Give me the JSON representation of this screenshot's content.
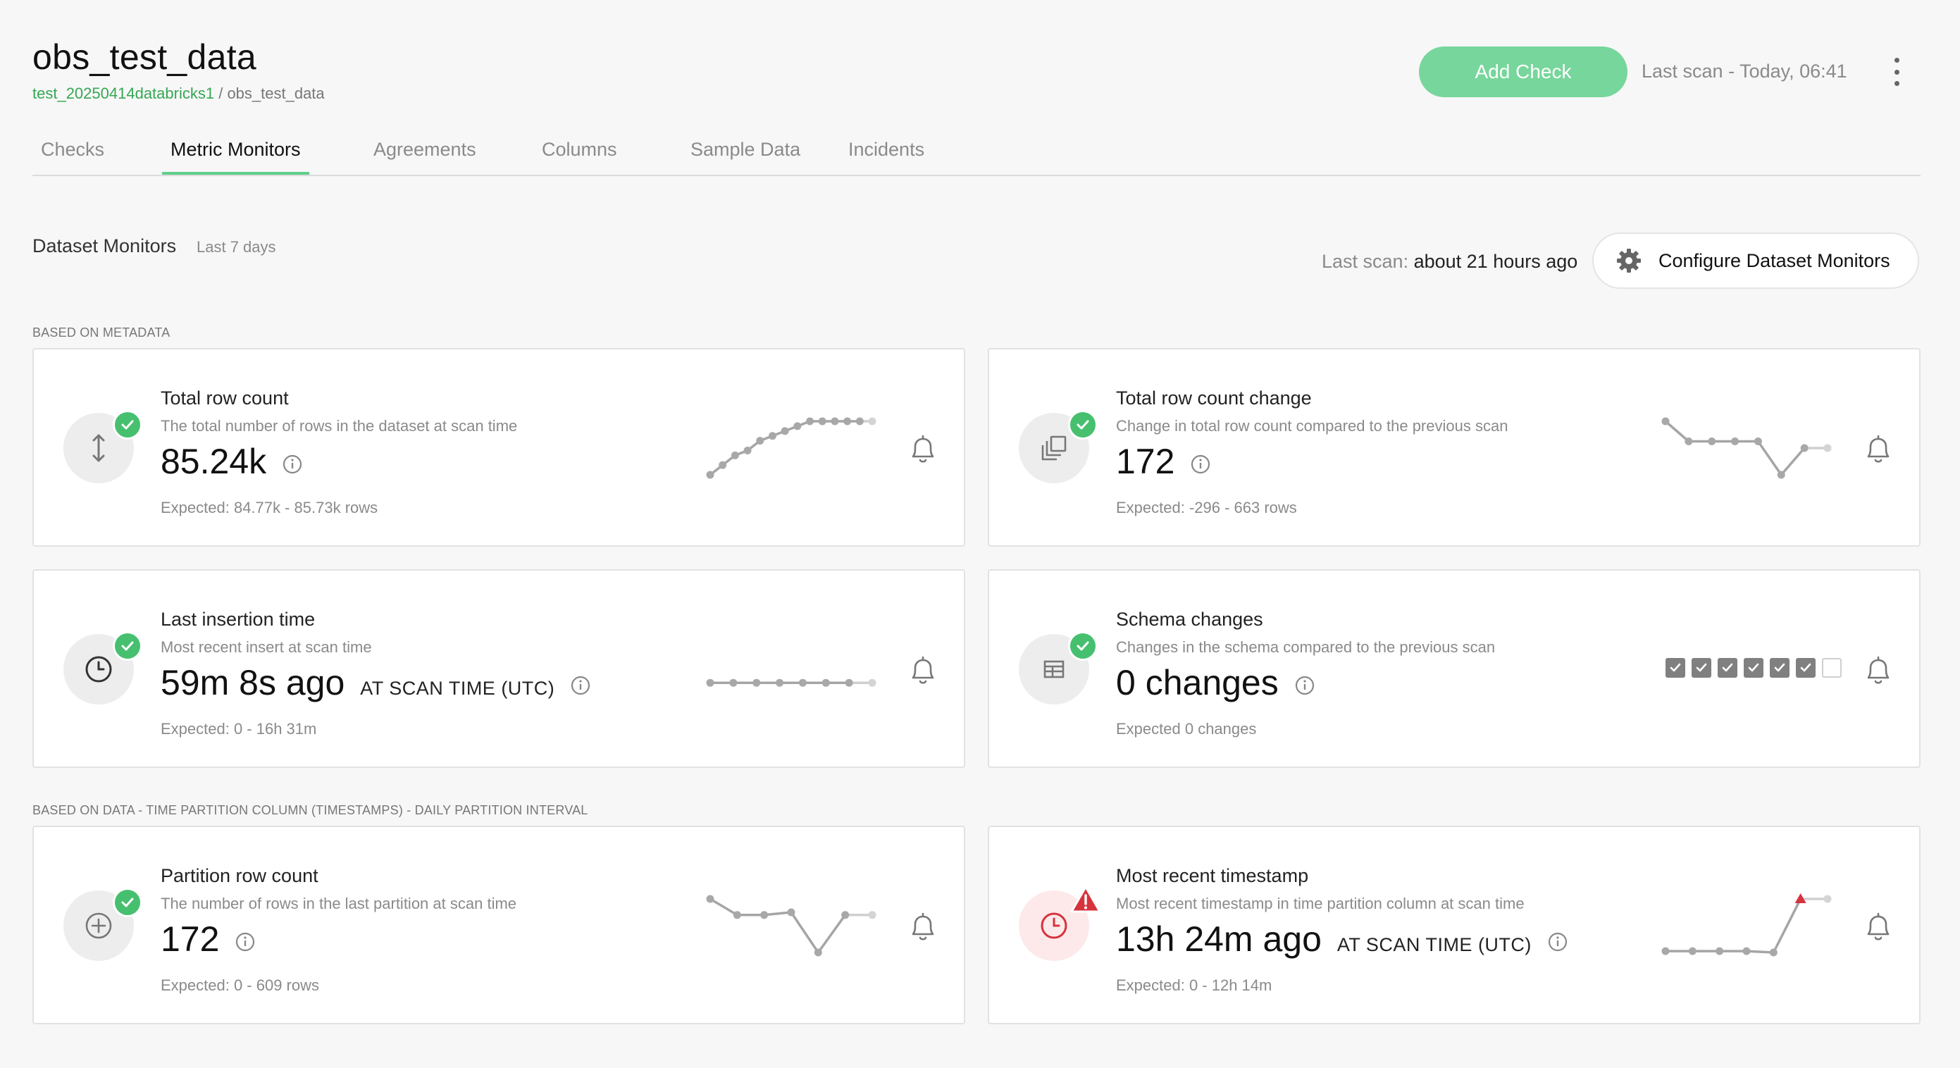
{
  "header": {
    "title": "obs_test_data",
    "breadcrumb_link": "test_20250414databricks1",
    "breadcrumb_sep": " / ",
    "breadcrumb_current": "obs_test_data",
    "add_check_label": "Add Check",
    "last_scan": "Last scan - Today, 06:41"
  },
  "tabs": [
    {
      "label": "Checks",
      "active": false
    },
    {
      "label": "Metric Monitors",
      "active": true
    },
    {
      "label": "Agreements",
      "active": false
    },
    {
      "label": "Columns",
      "active": false
    },
    {
      "label": "Sample Data",
      "active": false
    },
    {
      "label": "Incidents",
      "active": false
    }
  ],
  "section": {
    "title": "Dataset Monitors",
    "subtitle": "Last 7 days",
    "scan_label": "Last scan:",
    "scan_value": "about 21 hours ago",
    "configure_label": "Configure Dataset Monitors"
  },
  "groups": {
    "metadata_label": "BASED ON METADATA",
    "data_label": "BASED ON DATA - TIME PARTITION COLUMN (TIMESTAMPS) - DAILY PARTITION INTERVAL"
  },
  "cards": [
    {
      "title": "Total row count",
      "description": "The total number of rows in the dataset at scan time",
      "value": "85.24k",
      "suffix": "",
      "expected": "Expected: 84.77k - 85.73k rows",
      "status": "ok",
      "icon": "vertical-arrows-icon",
      "trend": [
        0,
        1,
        2,
        2.5,
        3.5,
        4,
        4.5,
        5,
        5.5,
        5.5,
        5.5,
        5.5,
        5.5,
        5.5
      ]
    },
    {
      "title": "Total row count change",
      "description": "Change in total row count compared to the previous scan",
      "value": "172",
      "suffix": "",
      "expected": "Expected: -296 - 663 rows",
      "status": "ok",
      "icon": "stacked-copy-icon",
      "trend": [
        4,
        2.5,
        2.5,
        2.5,
        2.5,
        0,
        2,
        2
      ]
    },
    {
      "title": "Last insertion time",
      "description": "Most recent insert at scan time",
      "value": "59m 8s ago",
      "suffix": "AT SCAN TIME (UTC)",
      "expected": "Expected: 0 - 16h 31m",
      "status": "ok",
      "icon": "clock-icon",
      "trend": [
        1,
        1,
        1,
        1,
        1,
        1,
        1,
        1
      ]
    },
    {
      "title": "Schema changes",
      "description": "Changes in the schema compared to the previous scan",
      "value": "0 changes",
      "suffix": "",
      "expected": "Expected 0 changes",
      "status": "ok",
      "icon": "table-icon",
      "schema_checks": [
        true,
        true,
        true,
        true,
        true,
        true,
        false
      ]
    },
    {
      "title": "Partition row count",
      "description": "The number of rows in the last partition at scan time",
      "value": "172",
      "suffix": "",
      "expected": "Expected: 0 - 609 rows",
      "status": "ok",
      "icon": "plus-circle-icon",
      "trend": [
        4,
        2.8,
        2.8,
        3,
        0,
        2.8,
        2.8
      ]
    },
    {
      "title": "Most recent timestamp",
      "description": "Most recent timestamp in time partition column at scan time",
      "value": "13h 24m ago",
      "suffix": "AT SCAN TIME (UTC)",
      "expected": "Expected: 0 - 12h 14m",
      "status": "alert",
      "icon": "clock-icon",
      "trend": [
        0.1,
        0.1,
        0.1,
        0.1,
        0,
        4,
        4
      ]
    }
  ],
  "colors": {
    "accent": "#5fcf8a",
    "ok": "#46c06f",
    "alert": "#d6333d",
    "button": "#77d69b"
  }
}
